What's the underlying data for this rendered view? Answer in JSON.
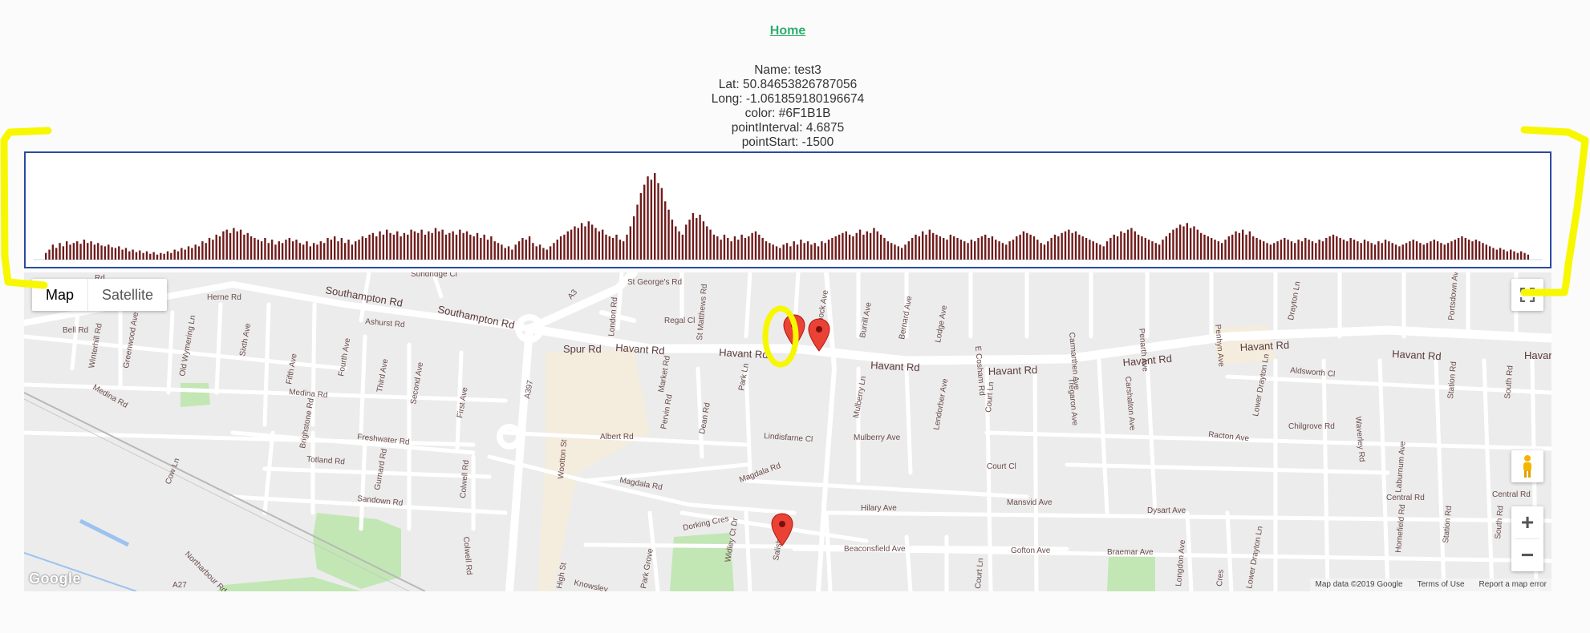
{
  "header": {
    "home_link": "Home"
  },
  "info": {
    "name": "Name: test3",
    "lat": "Lat: 50.84653826787056",
    "long": "Long: -1.061859180196674",
    "color": "color: #6F1B1B",
    "point_interval": "pointInterval: 4.6875",
    "point_start": "pointStart: -1500"
  },
  "colors": {
    "bar_color": "#6F1B1B",
    "link_color": "#2eae6b",
    "chart_border": "#2b4aa0",
    "annotation": "#f7f700",
    "marker": "#ea4335"
  },
  "chart_data": {
    "type": "bar",
    "series": [
      {
        "color": "#6F1B1B",
        "pointStart": -1500,
        "pointInterval": 4.6875,
        "values": [
          8,
          12,
          18,
          14,
          20,
          16,
          22,
          18,
          20,
          22,
          19,
          24,
          20,
          22,
          18,
          20,
          17,
          16,
          18,
          15,
          14,
          16,
          12,
          14,
          10,
          12,
          9,
          11,
          8,
          10,
          7,
          9,
          6,
          8,
          7,
          10,
          8,
          12,
          10,
          14,
          12,
          16,
          14,
          18,
          16,
          22,
          20,
          26,
          24,
          30,
          28,
          34,
          36,
          32,
          38,
          34,
          36,
          30,
          32,
          28,
          26,
          24,
          22,
          26,
          20,
          24,
          18,
          22,
          20,
          24,
          26,
          22,
          24,
          20,
          18,
          22,
          16,
          20,
          18,
          22,
          20,
          26,
          24,
          28,
          22,
          26,
          20,
          24,
          18,
          22,
          24,
          28,
          26,
          30,
          32,
          28,
          34,
          30,
          36,
          32,
          30,
          34,
          28,
          32,
          30,
          36,
          34,
          32,
          36,
          30,
          34,
          32,
          38,
          34,
          36,
          30,
          32,
          34,
          30,
          36,
          32,
          34,
          30,
          28,
          32,
          26,
          30,
          24,
          28,
          22,
          20,
          18,
          14,
          16,
          12,
          18,
          22,
          26,
          24,
          28,
          20,
          16,
          18,
          14,
          12,
          16,
          20,
          24,
          28,
          30,
          34,
          36,
          40,
          38,
          44,
          40,
          46,
          42,
          38,
          34,
          36,
          30,
          28,
          26,
          30,
          24,
          22,
          30,
          40,
          52,
          66,
          80,
          90,
          100,
          96,
          104,
          92,
          86,
          70,
          60,
          48,
          40,
          34,
          30,
          42,
          48,
          56,
          50,
          54,
          46,
          40,
          36,
          30,
          28,
          24,
          30,
          26,
          22,
          28,
          24,
          30,
          26,
          28,
          32,
          34,
          30,
          26,
          22,
          20,
          18,
          16,
          14,
          18,
          20,
          16,
          22,
          18,
          24,
          20,
          22,
          18,
          20,
          16,
          22,
          20,
          24,
          26,
          28,
          30,
          32,
          34,
          30,
          28,
          32,
          36,
          30,
          34,
          32,
          38,
          34,
          30,
          26,
          22,
          20,
          18,
          16,
          14,
          18,
          22,
          26,
          30,
          28,
          34,
          30,
          36,
          32,
          30,
          28,
          26,
          24,
          30,
          28,
          26,
          24,
          22,
          20,
          24,
          22,
          26,
          28,
          30,
          26,
          28,
          24,
          22,
          20,
          18,
          22,
          24,
          28,
          30,
          34,
          32,
          30,
          28,
          24,
          20,
          18,
          22,
          26,
          30,
          28,
          32,
          34,
          36,
          32,
          34,
          30,
          28,
          26,
          24,
          22,
          20,
          18,
          16,
          22,
          26,
          30,
          28,
          34,
          32,
          36,
          38,
          34,
          30,
          28,
          26,
          24,
          22,
          20,
          18,
          24,
          28,
          32,
          36,
          38,
          42,
          40,
          44,
          38,
          40,
          36,
          32,
          30,
          28,
          26,
          24,
          22,
          20,
          24,
          28,
          30,
          34,
          32,
          36,
          30,
          34,
          28,
          26,
          24,
          22,
          20,
          18,
          20,
          22,
          24,
          26,
          24,
          22,
          20,
          24,
          22,
          26,
          24,
          22,
          20,
          24,
          22,
          26,
          28,
          30,
          28,
          26,
          24,
          22,
          26,
          24,
          22,
          20,
          24,
          22,
          20,
          18,
          22,
          20,
          24,
          22,
          20,
          18,
          16,
          18,
          20,
          22,
          24,
          22,
          20,
          18,
          20,
          22,
          24,
          22,
          20,
          18,
          20,
          22,
          24,
          26,
          28,
          26,
          24,
          22,
          24,
          22,
          20,
          18,
          16,
          14,
          12,
          14,
          12,
          10,
          12,
          10,
          8,
          10,
          8,
          6
        ]
      }
    ]
  },
  "map": {
    "type_buttons": {
      "map": "Map",
      "satellite": "Satellite"
    },
    "logo": "Google",
    "attribution": {
      "data": "Map data ©2019 Google",
      "terms": "Terms of Use",
      "report": "Report a map error"
    },
    "zoom_in": "+",
    "zoom_out": "−",
    "road_labels": {
      "southampton_rd_1": "Southampton Rd",
      "southampton_rd_2": "Southampton Rd",
      "havant_rd_1": "Havant Rd",
      "havant_rd_2": "Havant Rd",
      "havant_rd_3": "Havant Rd",
      "havant_rd_4": "Havant Rd",
      "havant_rd_5": "Havant Rd",
      "havant_rd_6": "Havant Rd",
      "havant_rd_7": "Havant Rd",
      "havant_rd_8": "Havan",
      "spur_rd": "Spur Rd",
      "a3": "A3",
      "a397": "A397",
      "a27": "A27",
      "sundridge_cl": "Sundridge Cl",
      "st_georges_rd": "St George's Rd",
      "herne_rd": "Herne Rd",
      "regal_cl": "Regal Cl",
      "ashurst_rd": "Ashurst Rd",
      "bell_rd": "Bell Rd",
      "medina_rd_1": "Medina Rd",
      "medina_rd_2": "Medina Rd",
      "freshwater_rd": "Freshwater Rd",
      "totland_rd": "Totland Rd",
      "sandown_rd": "Sandown Rd",
      "albert_rd": "Albert Rd",
      "magdala_rd_1": "Magdala Rd",
      "magdala_rd_2": "Magdala Rd",
      "lindisfarne_cl": "Lindisfarne Cl",
      "mulberry_ave": "Mulberry Ave",
      "court_cl": "Court Cl",
      "hilary_ave": "Hilary Ave",
      "mansvid_ave": "Mansvid Ave",
      "dysart_ave": "Dysart Ave",
      "beaconsfield_ave": "Beaconsfield Ave",
      "gofton_ave": "Gofton Ave",
      "braemar_ave": "Braemar Ave",
      "dorking_cres": "Dorking Cres",
      "central_rd_1": "Central Rd",
      "central_rd_2": "Central Rd",
      "racton_ave": "Racton Ave",
      "chilgrove_rd": "Chilgrove Rd",
      "aldsworth_cl": "Aldsworth Cl",
      "high_st": "High St",
      "wootton_st": "Wootton St",
      "cow_ln": "Cow Ln",
      "northarbour_rd": "Northarbour Rd",
      "knowsley": "Knowsley",
      "park_grove": "Park Grove",
      "widley_ct_dr": "Widley Ct Dr",
      "salisbury": "Salisb",
      "winterhill_rd": "Winterhill Rd",
      "greenwood_ave": "Greenwood Ave",
      "old_wymering_ln": "Old Wymering Ln",
      "sixth_ave": "Sixth Ave",
      "fifth_ave": "Fifth Ave",
      "fourth_ave": "Fourth Ave",
      "third_ave": "Third Ave",
      "second_ave": "Second Ave",
      "first_ave": "First Ave",
      "brighstone_rd": "Brighstone Rd",
      "gurnard_rd": "Gurnard Rd",
      "colwell_rd_1": "Colwell Rd",
      "colwell_rd_2": "Colwell Rd",
      "london_rd": "London Rd",
      "st_matthews_rd": "St Matthews Rd",
      "market_rd": "Market Rd",
      "pervin_rd": "Pervin Rd",
      "dean_rd": "Dean Rd",
      "park_ln": "Park Ln",
      "padnock_ave": "Padnock Ave",
      "burrill_ave": "Burrill Ave",
      "bernard_ave": "Bernard Ave",
      "lodge_ave": "Lodge Ave",
      "e_cosham_rd": "E Cosham Rd",
      "mulberry_ln": "Mulberry Ln",
      "lendorber_ave": "Lendorber Ave",
      "court_ln_1": "Court Ln",
      "court_ln_2": "Court Ln",
      "carmarthen_ave": "Carmarthen Ave",
      "tregaron_ave": "Tregaron Ave",
      "penarth_ave": "Penarth Ave",
      "carshalton_ave": "Carshalton Ave",
      "penhyn_ave": "Penhyn Ave",
      "drayton_ln": "Drayton Ln",
      "lower_drayton_ln_1": "Lower Drayton Ln",
      "lower_drayton_ln_2": "Lower Drayton Ln",
      "waverley_rd": "Waverley Rd",
      "laburnum_ave": "Laburnum Ave",
      "station_rd_1": "Station Rd",
      "station_rd_2": "Station Rd",
      "portsdown_ave": "Portsdown Ave",
      "south_rd_1": "South Rd",
      "south_rd_2": "South Rd",
      "homefield_rd": "Homefield Rd",
      "longdon_ave": "Longdon Ave",
      "rd_top": "Rd",
      "cres": "Cres"
    }
  }
}
